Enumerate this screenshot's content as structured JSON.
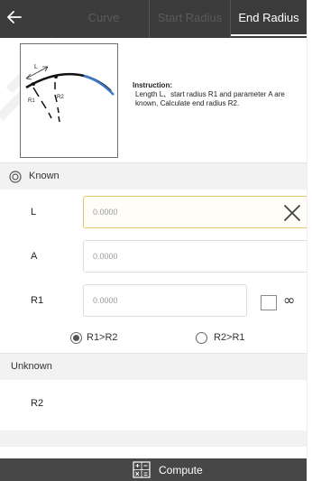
{
  "topbar": {
    "back_icon": "arrow-left-icon",
    "tabs": [
      {
        "label": "Curve",
        "active": false
      },
      {
        "label": "Start Radius",
        "active": false
      },
      {
        "label": "End Radius",
        "active": true
      }
    ]
  },
  "diagram": {
    "label_l": "L",
    "label_r1": "R1",
    "label_r2": "R2"
  },
  "instruction": {
    "title": "Instruction:",
    "text": "Length L、start radius R1 and parameter A are known, Calculate end radius R2."
  },
  "known": {
    "icon": "target-icon",
    "label": "Known",
    "fields": [
      {
        "name": "L",
        "value": "0.0000"
      },
      {
        "name": "A",
        "value": "0.0000"
      },
      {
        "name": "R1",
        "value": "0.0000"
      }
    ],
    "infinity_symbol": "∞",
    "infinity_checked": false,
    "clear_icon": "close-icon"
  },
  "radio": {
    "options": [
      {
        "label": "R1>R2",
        "selected": true
      },
      {
        "label": "R2>R1",
        "selected": false
      }
    ]
  },
  "unknown": {
    "label": "Unknown",
    "result_name": "R2"
  },
  "footer": {
    "compute_label": "Compute",
    "compute_icon": "calculator-icon"
  },
  "colors": {
    "topbar": "#3b3b3b",
    "active_field_border": "#e9c66a",
    "curve_blue": "#3a78c8",
    "footer": "#474747"
  }
}
